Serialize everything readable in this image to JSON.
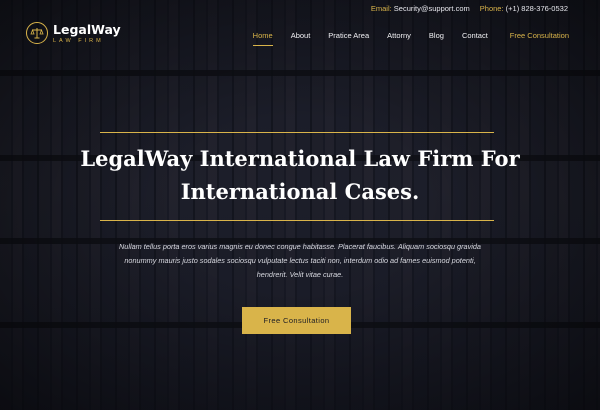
{
  "topbar": {
    "email_key": "Email:",
    "email_value": "Security@support.com",
    "phone_key": "Phone:",
    "phone_value": "(+1) 828-376-0532"
  },
  "logo": {
    "name": "LegalWay",
    "tagline": "LAW FIRM",
    "icon": "scales-of-justice-icon"
  },
  "nav": {
    "items": [
      "Home",
      "About",
      "Pratice Area",
      "Attorny",
      "Blog",
      "Contact"
    ],
    "cta": "Free Consultation"
  },
  "hero": {
    "title_line1": "LegalWay International Law Firm For",
    "title_line2": "International Cases.",
    "description_line1": "Nullam tellus porta eros varius magnis eu donec congue habitasse. Placerat faucibus. Aliquam sociosqu gravida",
    "description_line2": "nonummy mauris justo sodales sociosqu vulputate lectus taciti non, interdum odio ad fames euismod potenti,",
    "description_line3": "hendrerit. Velit vitae curae.",
    "button_label": "Free Consultation"
  },
  "colors": {
    "accent": "#d9b44a",
    "background": "#1a1d2a",
    "text": "#ffffff"
  }
}
